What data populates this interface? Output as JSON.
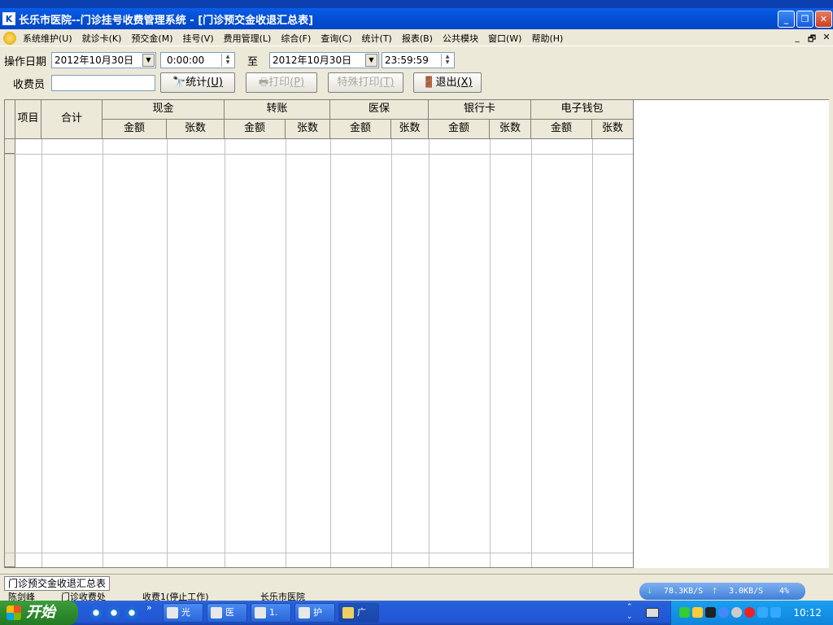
{
  "window": {
    "title": "长乐市医院--门诊挂号收费管理系统 - [门诊预交金收退汇总表]",
    "icon_text": "K"
  },
  "menu": [
    "系统维护(U)",
    "就诊卡(K)",
    "预交金(M)",
    "挂号(V)",
    "费用管理(L)",
    "综合(F)",
    "查询(C)",
    "统计(T)",
    "报表(B)",
    "公共模块",
    "窗口(W)",
    "帮助(H)"
  ],
  "mdi_controls": [
    "_",
    "🗗",
    "✕"
  ],
  "filters": {
    "date_label": "操作日期",
    "date_from": "2012年10月30日",
    "time_from": "0:00:00",
    "to_label": "至",
    "date_to": "2012年10月30日",
    "time_to": "23:59:59",
    "cashier_label": "收费员",
    "cashier_value": ""
  },
  "buttons": {
    "stats": "统计",
    "stats_key": "(U)",
    "print": "打印",
    "print_key": "(P)",
    "special_print": "特殊打印",
    "special_print_key": "(T)",
    "exit": "退出",
    "exit_key": "(X)"
  },
  "table": {
    "col_item": "项目",
    "col_total": "合计",
    "groups": [
      "现金",
      "转账",
      "医保",
      "银行卡",
      "电子钱包"
    ],
    "sub_amount": "金额",
    "sub_count": "张数"
  },
  "mdi_tab": "门诊预交金收退汇总表",
  "status_fragments": [
    "陈剑峰",
    "门诊收费处",
    "收费1(停止工作)",
    "长乐市医院"
  ],
  "netmon": {
    "down": "78.3KB/S",
    "up": "3.0KB/S",
    "pct": "4%"
  },
  "taskbar": {
    "start": "开始",
    "items": [
      "光",
      "医",
      "1.",
      "护",
      "广"
    ],
    "clock": "10:12"
  }
}
